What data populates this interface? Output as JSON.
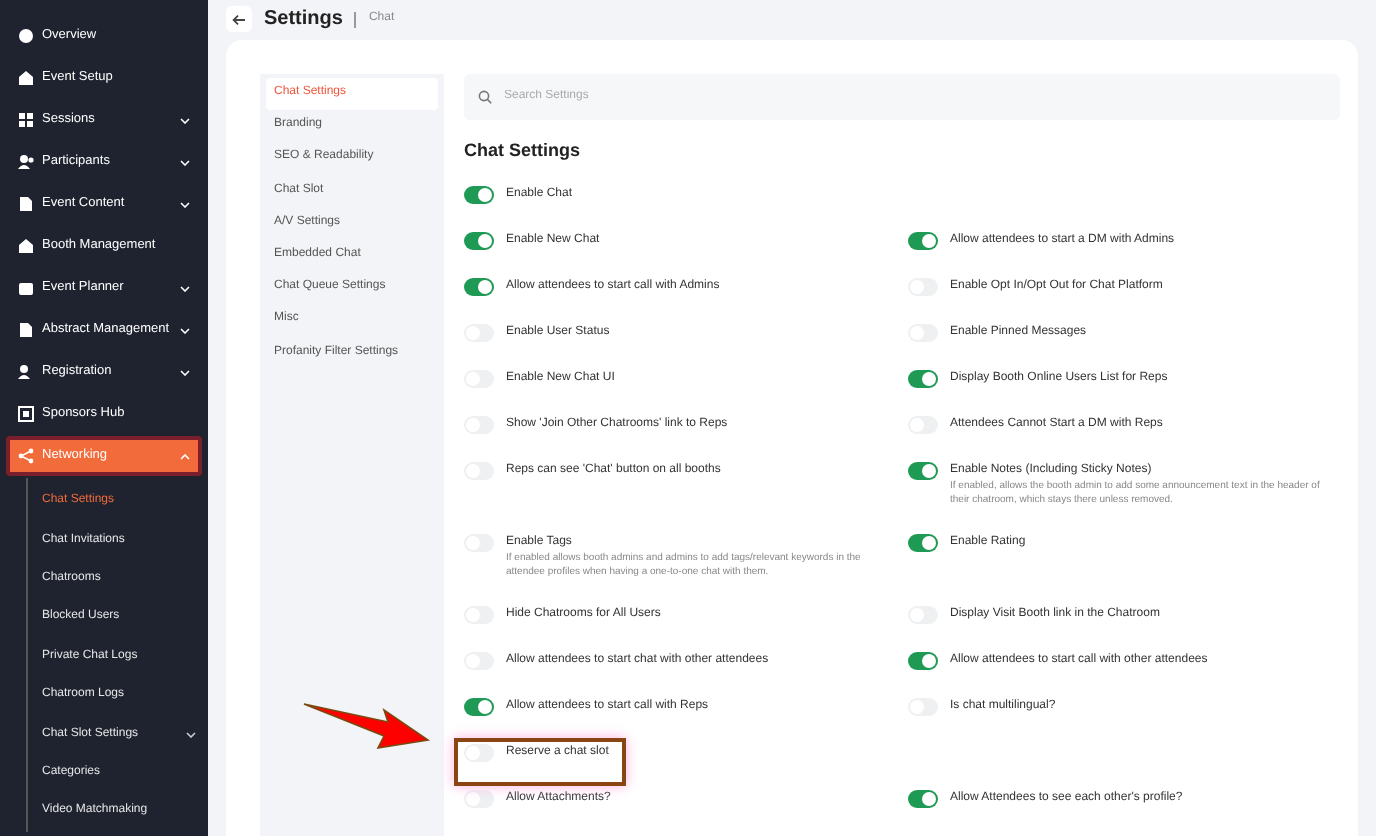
{
  "sidebar": {
    "items": [
      {
        "label": "Overview",
        "selected": false
      },
      {
        "label": "Event Setup",
        "selected": false
      },
      {
        "label": "Sessions",
        "expanded": false,
        "selected": false
      },
      {
        "label": "Participants",
        "expanded": false,
        "selected": false
      },
      {
        "label": "Event Content",
        "expanded": false,
        "selected": false
      },
      {
        "label": "Booth Management",
        "selected": false
      },
      {
        "label": "Event Planner",
        "expanded": false,
        "selected": false
      },
      {
        "label": "Abstract Management",
        "expanded": false,
        "selected": false
      },
      {
        "label": "Registration",
        "expanded": false,
        "selected": false
      },
      {
        "label": "Sponsors Hub",
        "selected": false
      },
      {
        "label": "Networking",
        "expanded": true,
        "selected": true,
        "children": [
          {
            "label": "Chat Settings",
            "selected": true
          },
          {
            "label": "Chat Invitations",
            "selected": false
          },
          {
            "label": "Chatrooms",
            "selected": false
          },
          {
            "label": "Blocked Users",
            "selected": false
          },
          {
            "label": "Private Chat Logs",
            "selected": false
          },
          {
            "label": "Chatroom Logs",
            "selected": false
          },
          {
            "label": "Chat Slot Settings",
            "selected": false,
            "expanded": false
          },
          {
            "label": "Categories",
            "selected": false
          },
          {
            "label": "Video Matchmaking",
            "selected": false
          }
        ]
      }
    ]
  },
  "header": {
    "title": "Settings",
    "breadcrumb": "Chat"
  },
  "settings_nav": [
    {
      "label": "Chat Settings",
      "selected": true
    },
    {
      "label": "Branding",
      "selected": false
    },
    {
      "label": "SEO & Readability",
      "selected": false
    },
    {
      "label": "Chat Slot",
      "selected": false
    },
    {
      "label": "A/V Settings",
      "selected": false
    },
    {
      "label": "Embedded Chat",
      "selected": false
    },
    {
      "label": "Chat Queue Settings",
      "selected": false
    },
    {
      "label": "Misc",
      "selected": false
    },
    {
      "label": "Profanity Filter Settings",
      "selected": false
    }
  ],
  "search": {
    "placeholder": "Search Settings"
  },
  "section_title": "Chat Settings",
  "rows": [
    {
      "left": {
        "label": "Enable Chat",
        "on": true
      },
      "right": null
    },
    {
      "left": {
        "label": "Enable New Chat",
        "on": true
      },
      "right": {
        "label": "Allow attendees to start a DM with Admins",
        "on": true
      }
    },
    {
      "left": {
        "label": "Allow attendees to start call with Admins",
        "on": true
      },
      "right": {
        "label": "Enable Opt In/Opt Out for Chat Platform",
        "on": false
      }
    },
    {
      "left": {
        "label": "Enable User Status",
        "on": false
      },
      "right": {
        "label": "Enable Pinned Messages",
        "on": false
      }
    },
    {
      "left": {
        "label": "Enable New Chat UI",
        "on": false
      },
      "right": {
        "label": "Display Booth Online Users List for Reps",
        "on": true
      }
    },
    {
      "left": {
        "label": "Show 'Join Other Chatrooms' link to Reps",
        "on": false
      },
      "right": {
        "label": "Attendees Cannot Start a DM with Reps",
        "on": false
      }
    },
    {
      "left": {
        "label": "Reps can see 'Chat' button on all booths",
        "on": false
      },
      "right": {
        "label": "Enable Notes (Including Sticky Notes)",
        "on": true,
        "description": "If enabled, allows the booth admin to add some announcement text in the header of their chatroom, which stays there unless removed."
      }
    },
    {
      "left": {
        "label": "Enable Tags",
        "on": false,
        "description": "If enabled allows booth admins and admins to add tags/relevant keywords in the attendee profiles when having a one-to-one chat with them."
      },
      "right": {
        "label": "Enable Rating",
        "on": true
      }
    },
    {
      "left": {
        "label": "Hide Chatrooms for All Users",
        "on": false
      },
      "right": {
        "label": "Display Visit Booth link in the Chatroom",
        "on": false
      }
    },
    {
      "left": {
        "label": "Allow attendees to start chat with other attendees",
        "on": false
      },
      "right": {
        "label": "Allow attendees to start call with other attendees",
        "on": true
      }
    },
    {
      "left": {
        "label": "Allow attendees to start call with Reps",
        "on": true
      },
      "right": {
        "label": "Is chat multilingual?",
        "on": false
      }
    },
    {
      "left": {
        "label": "Reserve a chat slot",
        "on": false
      },
      "right": null
    },
    {
      "left": {
        "label": "Allow Attachments?",
        "on": false
      },
      "right": {
        "label": "Allow Attendees to see each other's profile?",
        "on": true
      }
    }
  ]
}
